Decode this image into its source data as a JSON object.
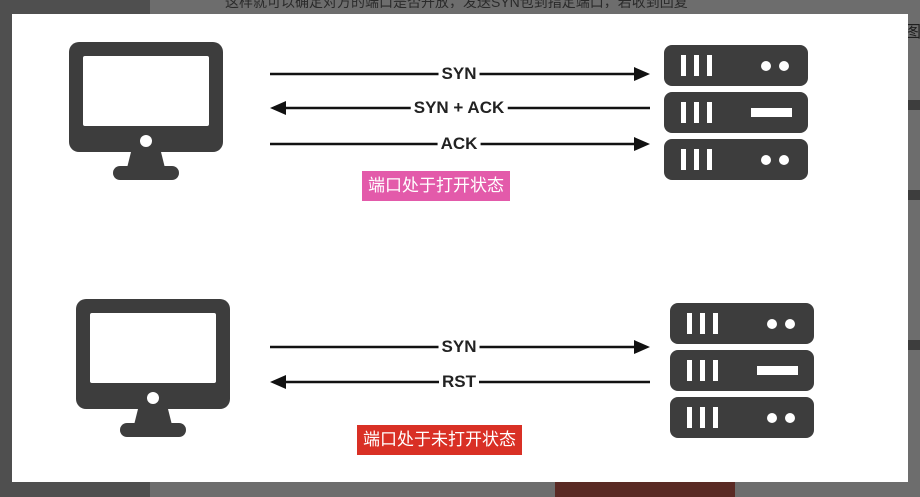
{
  "background": {
    "text_line": "这样就可以确定对方的端口是否开放，发送SYN包到指定端口，若收到回复",
    "edge_glyph": "图"
  },
  "colors": {
    "open_badge": "#e35aaa",
    "closed_badge": "#d93025",
    "device": "#3d3d3d",
    "arrow": "#111111"
  },
  "scenarios": [
    {
      "client_icon": "desktop-monitor-icon",
      "server_icon": "server-rack-icon",
      "messages": [
        {
          "label": "SYN",
          "direction": "right"
        },
        {
          "label": "SYN + ACK",
          "direction": "left"
        },
        {
          "label": "ACK",
          "direction": "right"
        }
      ],
      "state_label": "端口处于打开状态"
    },
    {
      "client_icon": "desktop-monitor-icon",
      "server_icon": "server-rack-icon",
      "messages": [
        {
          "label": "SYN",
          "direction": "right"
        },
        {
          "label": "RST",
          "direction": "left"
        }
      ],
      "state_label": "端口处于未打开状态"
    }
  ]
}
